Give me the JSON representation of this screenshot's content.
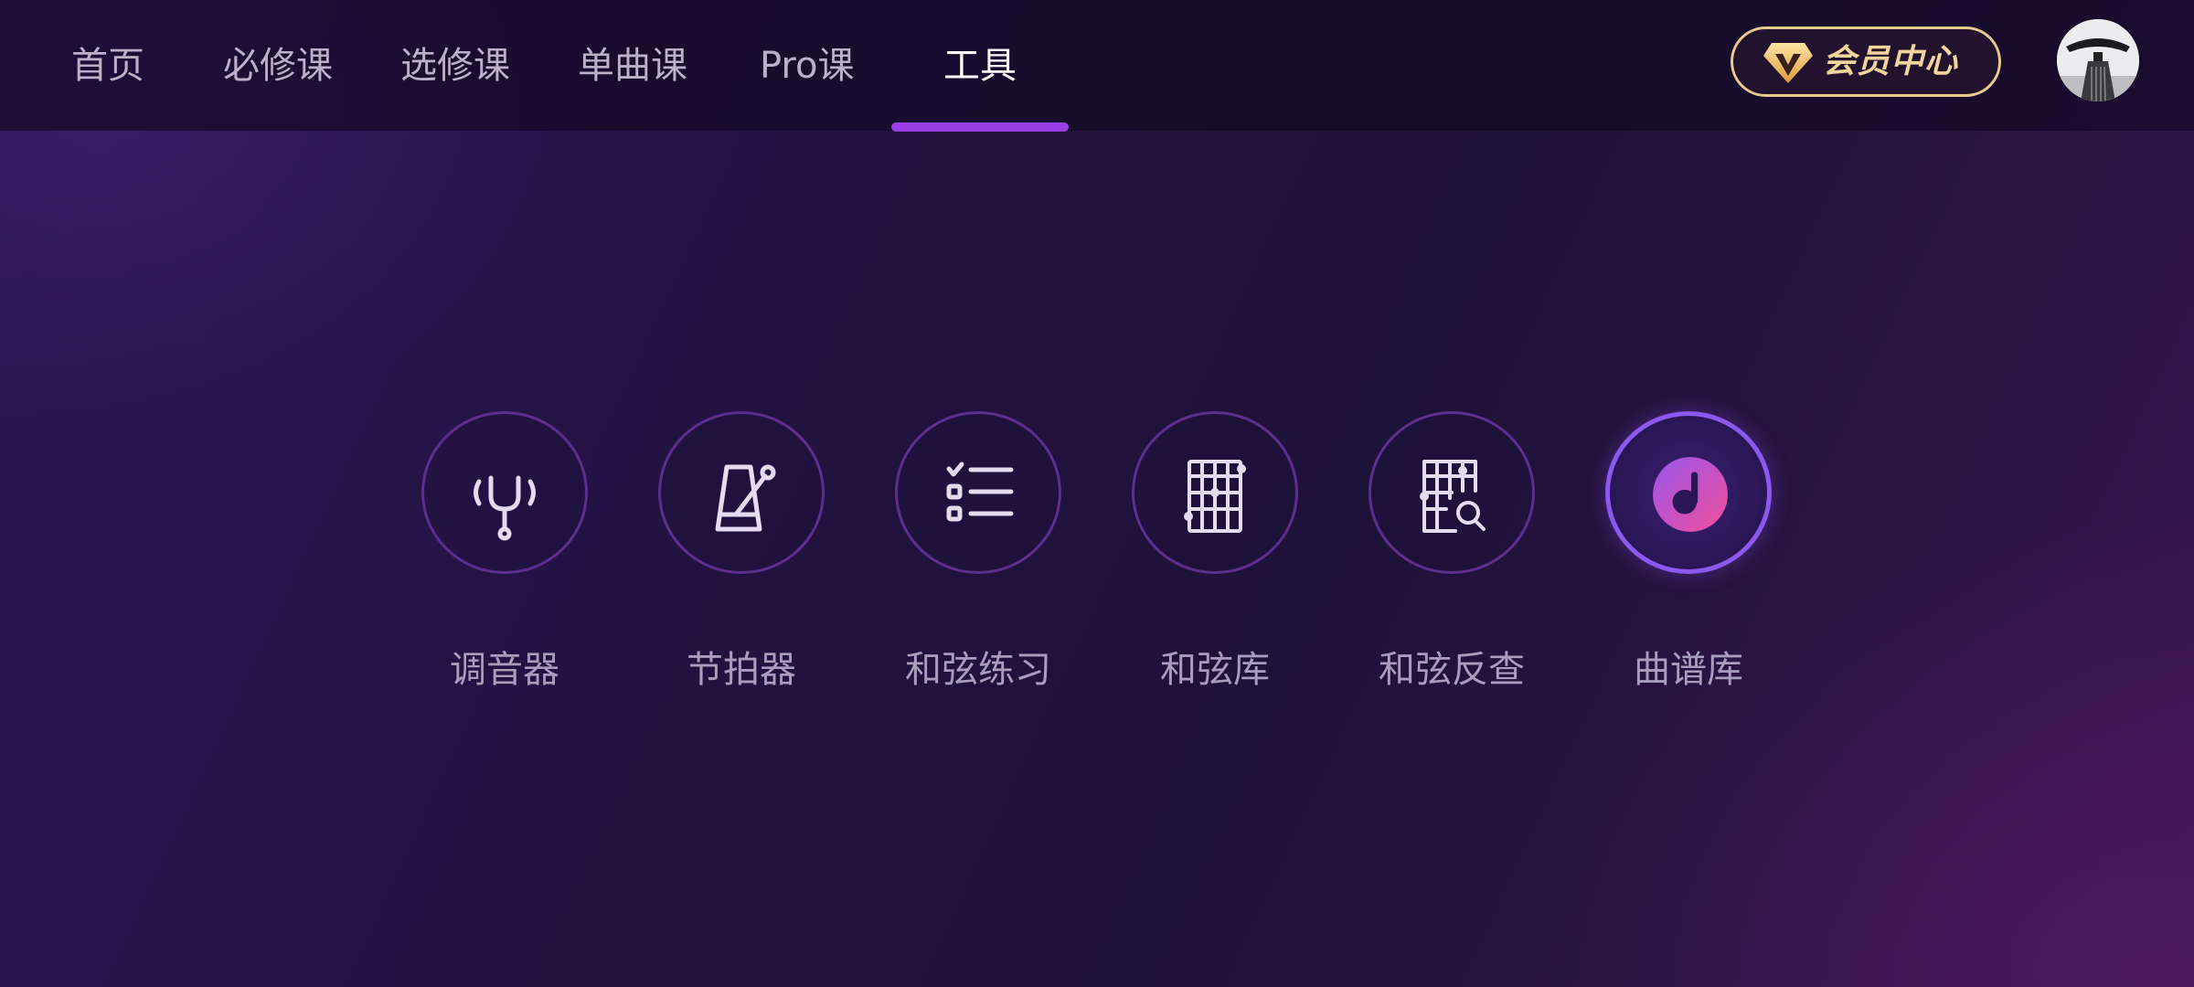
{
  "nav": {
    "tabs": [
      {
        "label": "首页"
      },
      {
        "label": "必修课"
      },
      {
        "label": "选修课"
      },
      {
        "label": "单曲课"
      },
      {
        "label": "Pro课"
      },
      {
        "label": "工具"
      }
    ],
    "active_tab": "工具"
  },
  "vip": {
    "label": "会员中心",
    "icon": "vip-diamond-icon"
  },
  "avatar": {
    "icon": "user-avatar"
  },
  "tools": [
    {
      "label": "调音器",
      "icon": "tuning-fork-icon"
    },
    {
      "label": "节拍器",
      "icon": "metronome-icon"
    },
    {
      "label": "和弦练习",
      "icon": "checklist-icon"
    },
    {
      "label": "和弦库",
      "icon": "chord-grid-icon"
    },
    {
      "label": "和弦反查",
      "icon": "chord-search-icon"
    },
    {
      "label": "曲谱库",
      "icon": "music-note-disc-icon"
    }
  ],
  "selected_tool": "曲谱库",
  "colors": {
    "accent": "#9a3fe8",
    "vip_gold": "#e8c98e",
    "label": "#a89dbd",
    "background": "#21123f"
  }
}
